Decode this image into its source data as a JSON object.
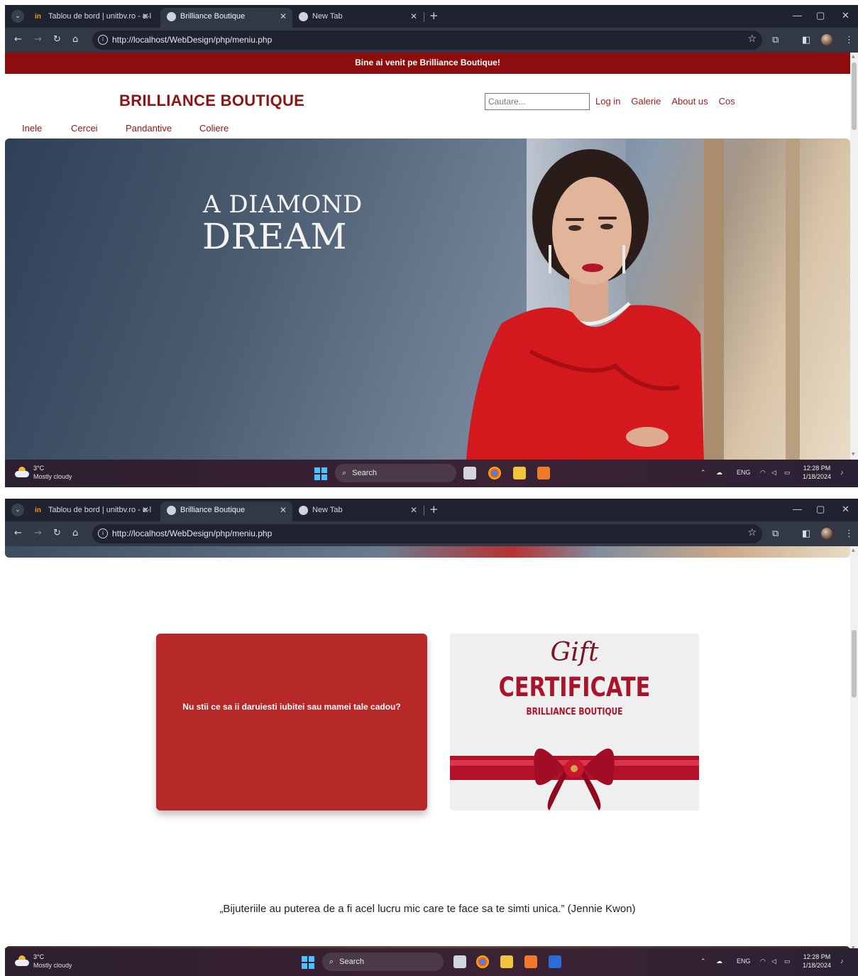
{
  "browser": {
    "tabs": [
      {
        "title": "Tablou de bord | unitbv.ro - e-l",
        "icon": "in-logo-icon"
      },
      {
        "title": "Brilliance Boutique",
        "icon": "globe-icon"
      },
      {
        "title": "New Tab",
        "icon": "chrome-icon"
      }
    ],
    "active_tab": 1,
    "url": "http://localhost/WebDesign/php/meniu.php"
  },
  "page": {
    "welcome_banner": "Bine ai venit pe Brilliance Boutique!",
    "brand": "BRILLIANCE BOUTIQUE",
    "search_placeholder": "Cautare...",
    "top_links": [
      "Log in",
      "Galerie",
      "About us",
      "Cos"
    ],
    "categories": [
      "Inele",
      "Cercei",
      "Pandantive",
      "Coliere"
    ],
    "hero": {
      "line1": "A DIAMOND",
      "line2": "DREAM"
    },
    "gift_card": {
      "text": "Nu stii ce sa ii daruiesti iubitei sau mamei tale cadou?",
      "image_script": "Gift",
      "image_title": "CERTIFICATE",
      "image_subtitle": "BRILLIANCE BOUTIQUE"
    },
    "quote": "„Bijuteriile au puterea de a fi acel lucru mic care te face sa te simti unica.” (Jennie Kwon)"
  },
  "taskbar": {
    "temperature": "3°C",
    "weather": "Mostly cloudy",
    "search": "Search",
    "language": "ENG",
    "time": "12:28 PM",
    "date": "1/18/2024"
  },
  "colors": {
    "banner": "#8b0d0d",
    "brand": "#8b1414",
    "card": "#b72828",
    "chrome_dark": "#1f2330",
    "chrome_toolbar": "#323846"
  }
}
